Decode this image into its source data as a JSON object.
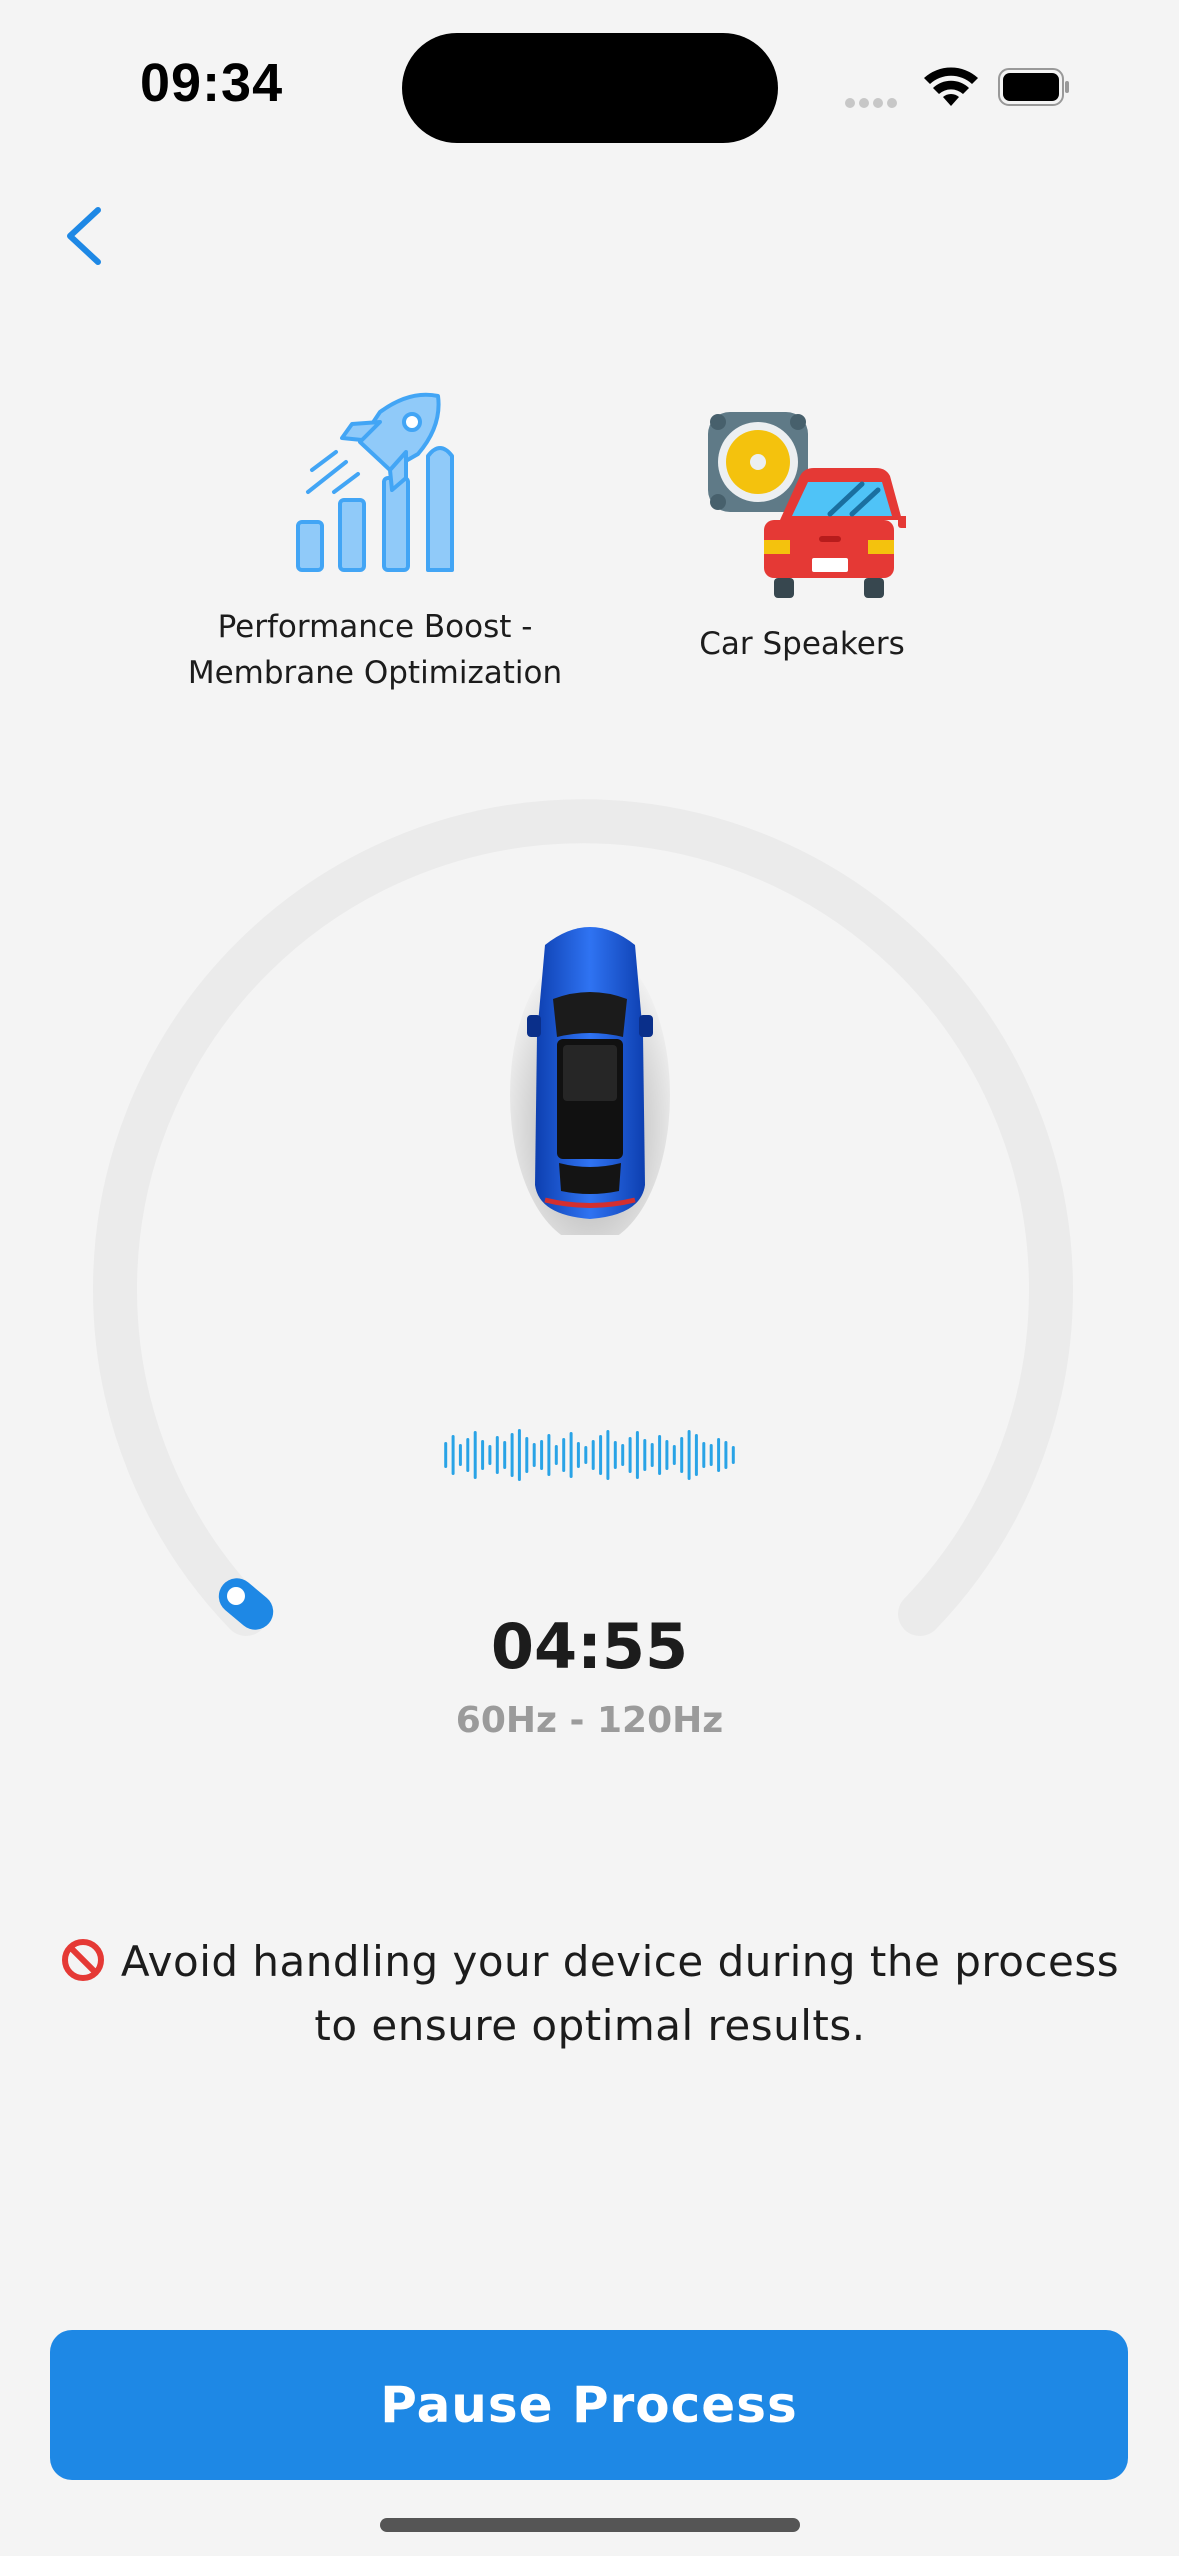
{
  "status_bar": {
    "time": "09:34"
  },
  "nav": {
    "back_icon": "chevron-left-icon"
  },
  "features": [
    {
      "icon": "rocket-bars-icon",
      "label": "Performance Boost - Membrane Optimization"
    },
    {
      "icon": "car-speaker-icon",
      "label": "Car Speakers"
    }
  ],
  "process": {
    "timer": "04:55",
    "frequency_range": "60Hz - 120Hz",
    "progress_fraction": 0.02
  },
  "warning": {
    "icon": "prohibited-icon",
    "text": "Avoid handling your device during the process to ensure optimal results."
  },
  "actions": {
    "pause_label": "Pause Process"
  },
  "colors": {
    "accent": "#1e88e5",
    "ring_track": "#ebebeb",
    "wave": "#29a3e6"
  }
}
